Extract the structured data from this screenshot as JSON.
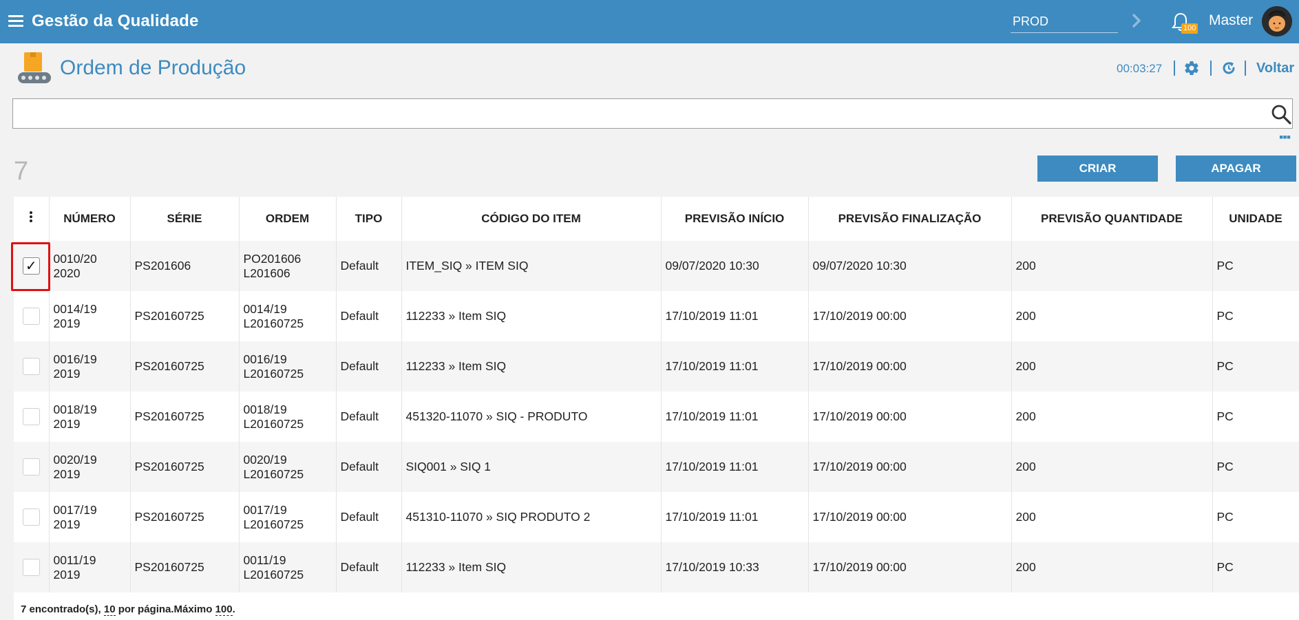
{
  "header": {
    "app_title": "Gestão da Qualidade",
    "environment": "PROD",
    "notification_count": "100",
    "user_name": "Master"
  },
  "page": {
    "title": "Ordem de Produção",
    "timer": "00:03:27",
    "back_label": "Voltar"
  },
  "search": {
    "value": "",
    "placeholder": ""
  },
  "results_count": "7",
  "actions": {
    "create_label": "CRIAR",
    "delete_label": "APAGAR"
  },
  "table": {
    "columns": [
      "NÚMERO",
      "SÉRIE",
      "ORDEM",
      "TIPO",
      "CÓDIGO DO ITEM",
      "PREVISÃO INÍCIO",
      "PREVISÃO FINALIZAÇÃO",
      "PREVISÃO QUANTIDADE",
      "UNIDADE"
    ],
    "rows": [
      {
        "checked": true,
        "numero_1": "0010/20",
        "numero_2": "2020",
        "serie": "PS201606",
        "ordem_1": "PO201606",
        "ordem_2": "L201606",
        "tipo": "Default",
        "codigo": "ITEM_SIQ » ITEM SIQ",
        "inicio": "09/07/2020 10:30",
        "fim": "09/07/2020 10:30",
        "qtd": "200",
        "unidade": "PC"
      },
      {
        "checked": false,
        "numero_1": "0014/19",
        "numero_2": "2019",
        "serie": "PS20160725",
        "ordem_1": "0014/19",
        "ordem_2": "L20160725",
        "tipo": "Default",
        "codigo": "112233 » Item SIQ",
        "inicio": "17/10/2019 11:01",
        "fim": "17/10/2019 00:00",
        "qtd": "200",
        "unidade": "PC"
      },
      {
        "checked": false,
        "numero_1": "0016/19",
        "numero_2": "2019",
        "serie": "PS20160725",
        "ordem_1": "0016/19",
        "ordem_2": "L20160725",
        "tipo": "Default",
        "codigo": "112233 » Item SIQ",
        "inicio": "17/10/2019 11:01",
        "fim": "17/10/2019 00:00",
        "qtd": "200",
        "unidade": "PC"
      },
      {
        "checked": false,
        "numero_1": "0018/19",
        "numero_2": "2019",
        "serie": "PS20160725",
        "ordem_1": "0018/19",
        "ordem_2": "L20160725",
        "tipo": "Default",
        "codigo": "451320-11070 » SIQ - PRODUTO",
        "inicio": "17/10/2019 11:01",
        "fim": "17/10/2019 00:00",
        "qtd": "200",
        "unidade": "PC"
      },
      {
        "checked": false,
        "numero_1": "0020/19",
        "numero_2": "2019",
        "serie": "PS20160725",
        "ordem_1": "0020/19",
        "ordem_2": "L20160725",
        "tipo": "Default",
        "codigo": "SIQ001 » SIQ 1",
        "inicio": "17/10/2019 11:01",
        "fim": "17/10/2019 00:00",
        "qtd": "200",
        "unidade": "PC"
      },
      {
        "checked": false,
        "numero_1": "0017/19",
        "numero_2": "2019",
        "serie": "PS20160725",
        "ordem_1": "0017/19",
        "ordem_2": "L20160725",
        "tipo": "Default",
        "codigo": "451310-11070 » SIQ PRODUTO 2",
        "inicio": "17/10/2019 11:01",
        "fim": "17/10/2019 00:00",
        "qtd": "200",
        "unidade": "PC"
      },
      {
        "checked": false,
        "numero_1": "0011/19",
        "numero_2": "2019",
        "serie": "PS20160725",
        "ordem_1": "0011/19",
        "ordem_2": "L20160725",
        "tipo": "Default",
        "codigo": "112233 » Item SIQ",
        "inicio": "17/10/2019 10:33",
        "fim": "17/10/2019 00:00",
        "qtd": "200",
        "unidade": "PC"
      }
    ]
  },
  "footer": {
    "found_text": "7 encontrado(s),",
    "per_page_value": "10",
    "per_page_text": "por página.Máximo",
    "max_value": "100",
    "end_text": "."
  },
  "colors": {
    "primary": "#3d8bc0",
    "badge": "#f2a51a",
    "highlight": "#e01010"
  }
}
